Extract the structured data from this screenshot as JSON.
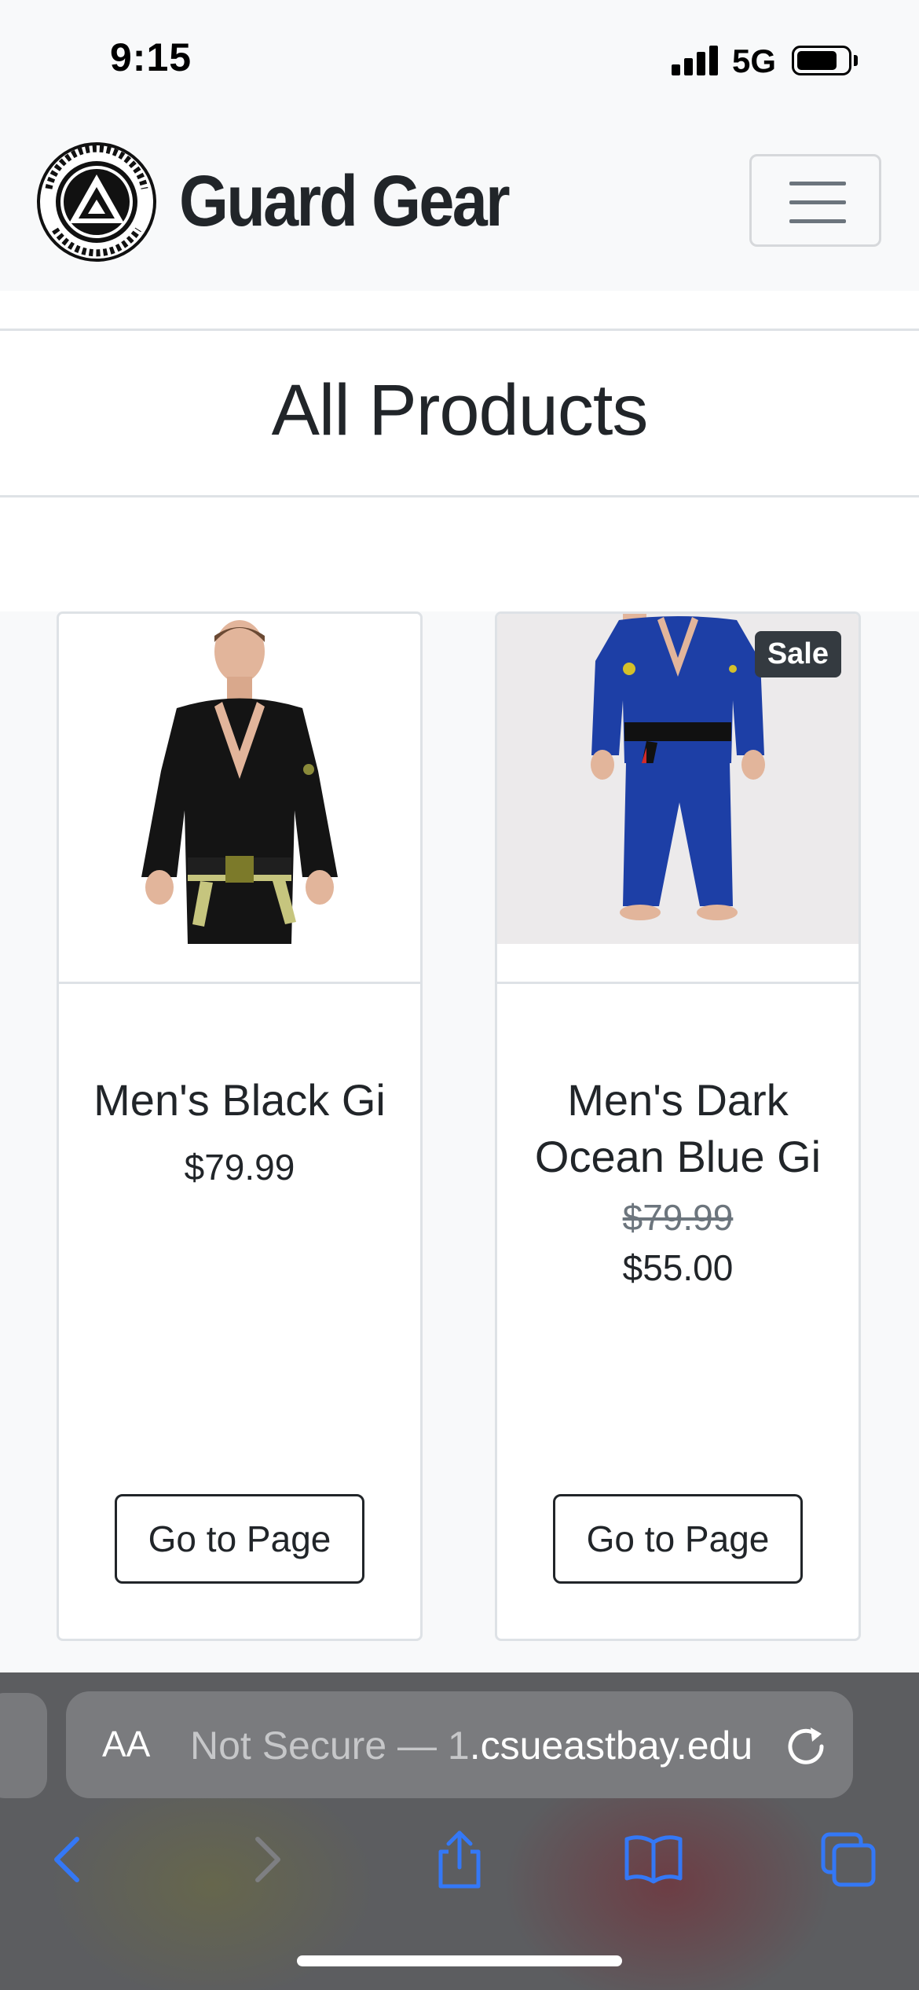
{
  "status_bar": {
    "time": "9:15",
    "network": "5G"
  },
  "navbar": {
    "logo_text": "GRACIE FIGHTER JIU-JITSU",
    "brand": "Guard Gear",
    "menu_icon": "hamburger-icon"
  },
  "page": {
    "title": "All Products"
  },
  "products": [
    {
      "name": "Men's Black Gi",
      "price": "$79.99",
      "button": "Go to Page",
      "image": "black-gi-photo"
    },
    {
      "name": "Men's Dark Ocean Blue Gi",
      "badge": "Sale",
      "original_price": "$79.99",
      "price": "$55.00",
      "button": "Go to Page",
      "image": "blue-gi-photo"
    }
  ],
  "browser": {
    "text_size_label": "AA",
    "url_prefix": "Not Secure — 1",
    "url_domain": ".csueastbay.edu",
    "icons": [
      "reload-icon",
      "back-icon",
      "forward-icon",
      "share-icon",
      "bookmarks-icon",
      "tabs-icon"
    ],
    "accent_color": "#3478f6"
  }
}
